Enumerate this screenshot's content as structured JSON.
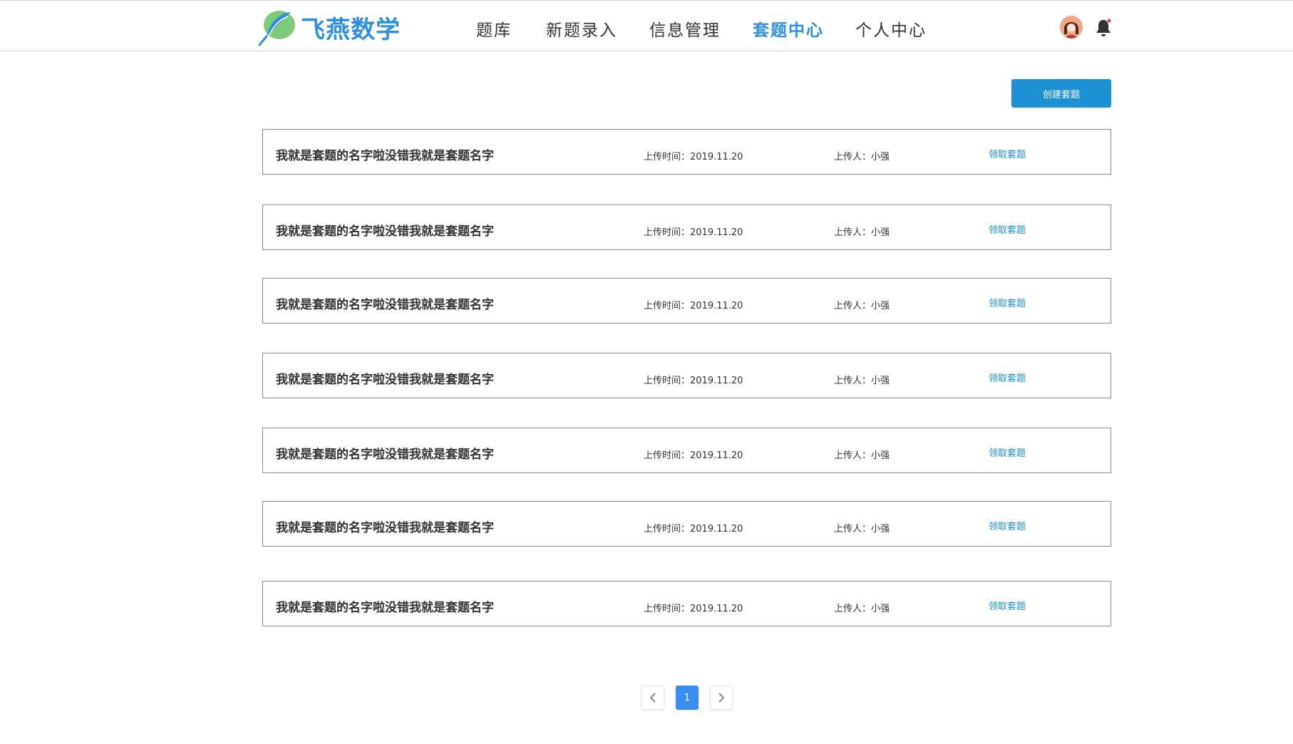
{
  "header": {
    "logo_text": "飞燕数学",
    "nav": [
      {
        "label": "题库",
        "active": false
      },
      {
        "label": "新题录入",
        "active": false
      },
      {
        "label": "信息管理",
        "active": false
      },
      {
        "label": "套题中心",
        "active": true
      },
      {
        "label": "个人中心",
        "active": false
      }
    ]
  },
  "toolbar": {
    "create_label": "创建套题"
  },
  "sets": [
    {
      "name": "我就是套题的名字啦没错我就是套题名字",
      "time": "上传时间：2019.11.20",
      "uploader": "上传人：小强",
      "action": "领取套题"
    },
    {
      "name": "我就是套题的名字啦没错我就是套题名字",
      "time": "上传时间：2019.11.20",
      "uploader": "上传人：小强",
      "action": "领取套题"
    },
    {
      "name": "我就是套题的名字啦没错我就是套题名字",
      "time": "上传时间：2019.11.20",
      "uploader": "上传人：小强",
      "action": "领取套题"
    },
    {
      "name": "我就是套题的名字啦没错我就是套题名字",
      "time": "上传时间：2019.11.20",
      "uploader": "上传人：小强",
      "action": "领取套题"
    },
    {
      "name": "我就是套题的名字啦没错我就是套题名字",
      "time": "上传时间：2019.11.20",
      "uploader": "上传人：小强",
      "action": "领取套题"
    },
    {
      "name": "我就是套题的名字啦没错我就是套题名字",
      "time": "上传时间：2019.11.20",
      "uploader": "上传人：小强",
      "action": "领取套题"
    },
    {
      "name": "我就是套题的名字啦没错我就是套题名字",
      "time": "上传时间：2019.11.20",
      "uploader": "上传人：小强",
      "action": "领取套题"
    }
  ],
  "pagination": {
    "current_page": "1"
  },
  "colors": {
    "accent": "#2f8fde",
    "button": "#1d8fd3",
    "page_current": "#3a8ef0"
  }
}
